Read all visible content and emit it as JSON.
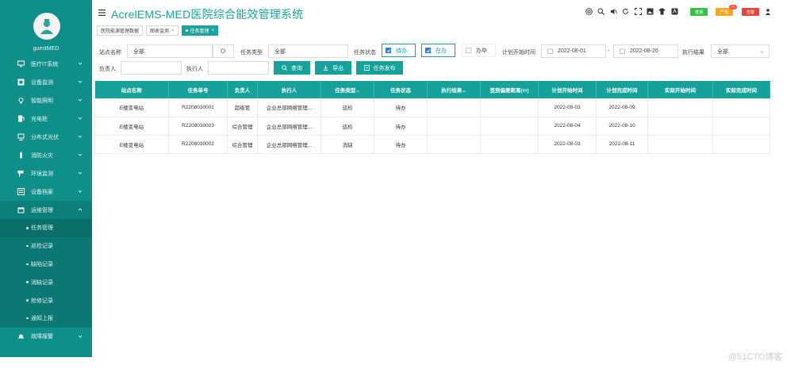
{
  "app": {
    "title": "AcrelEMS-MED医院综合能效管理系统"
  },
  "user": {
    "name": "guestMED"
  },
  "sidebar": {
    "items": [
      {
        "label": "医疗IT系统",
        "icon": "monitor-icon"
      },
      {
        "label": "设备监测",
        "icon": "device-icon"
      },
      {
        "label": "智能照明",
        "icon": "bulb-icon"
      },
      {
        "label": "充电桩",
        "icon": "charger-icon"
      },
      {
        "label": "分布式光伏",
        "icon": "solar-icon"
      },
      {
        "label": "消防火灾",
        "icon": "fire-extinguisher-icon"
      },
      {
        "label": "环境监测",
        "icon": "camera-icon"
      },
      {
        "label": "设备档案",
        "icon": "archive-icon"
      },
      {
        "label": "运维管理",
        "icon": "calendar-icon"
      }
    ],
    "sub_items": [
      {
        "label": "任务管理"
      },
      {
        "label": "巡检记录"
      },
      {
        "label": "缺陷记录"
      },
      {
        "label": "消缺记录"
      },
      {
        "label": "抢修记录"
      },
      {
        "label": "通知上报"
      }
    ],
    "bottom_item": {
      "label": "故障报警",
      "icon": "bell-icon"
    }
  },
  "header": {
    "icons": [
      "help-icon",
      "search-icon",
      "mute-icon",
      "refresh-icon",
      "fullscreen-icon",
      "image-icon",
      "shirt-icon",
      "translate-icon"
    ],
    "badges": {
      "green": "普通",
      "orange": "严重",
      "red": "告警",
      "red_count": "7"
    }
  },
  "tabs": [
    {
      "label": "医院能源管理数据"
    },
    {
      "label": "图表监测",
      "close": "×"
    },
    {
      "label": "任务管理",
      "close": "×"
    }
  ],
  "filters": {
    "station_label": "站点名称",
    "station_value": "全部",
    "task_type_label": "任务类型",
    "task_type_value": "全部",
    "task_status_label": "任务状态",
    "status_todo": "待办",
    "status_inprogress": "在办",
    "status_done": "办毕",
    "plan_start_label": "计划开始时间",
    "date_from": "2022-08-01",
    "date_sep": "-",
    "date_to": "2022-08-26",
    "exec_result_label": "执行结果",
    "exec_result_value": "全部",
    "owner_label": "负责人",
    "owner_value": "",
    "executor_label": "执行人",
    "executor_value": ""
  },
  "buttons": {
    "query": "查询",
    "export": "导出",
    "publish": "任务发布"
  },
  "table": {
    "columns": [
      "站点名称",
      "任务单号",
      "负责人",
      "执行人",
      "任务类型⌄",
      "任务状态",
      "执行结果⌄",
      "签到偏差距离(m)",
      "计划开始时间",
      "计划完成时间",
      "实际开始时间",
      "实际完成时间"
    ],
    "rows": [
      [
        "E楼变电站",
        "R2208030001",
        "超级管",
        "企业总部网络管理...",
        "巡检",
        "待办",
        "",
        "",
        "2022-08-03",
        "2022-08-09",
        "",
        ""
      ],
      [
        "E楼变电站",
        "R2208030003",
        "综合管理",
        "企业总部网络管理...",
        "巡检",
        "待办",
        "",
        "",
        "2022-08-04",
        "2022-08-10",
        "",
        ""
      ],
      [
        "E楼变电站",
        "R2208030002",
        "综合管理",
        "企业总部网络管理...",
        "消缺",
        "待办",
        "",
        "",
        "2022-08-03",
        "2022-08-11",
        "",
        ""
      ]
    ]
  },
  "watermark": "@51CTO博客"
}
